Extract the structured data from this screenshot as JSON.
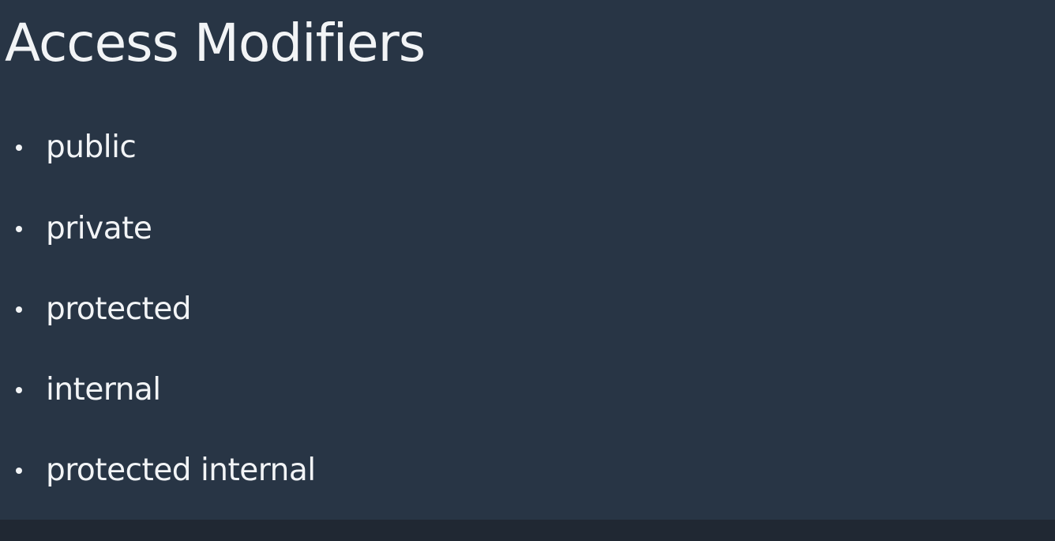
{
  "colors": {
    "background": "#283545",
    "text": "#f2f4f6",
    "footer_bar": "#202833"
  },
  "slide": {
    "title": "Access Modifiers",
    "bullets": [
      {
        "label": "public"
      },
      {
        "label": "private"
      },
      {
        "label": "protected"
      },
      {
        "label": "internal"
      },
      {
        "label": "protected internal"
      }
    ]
  }
}
